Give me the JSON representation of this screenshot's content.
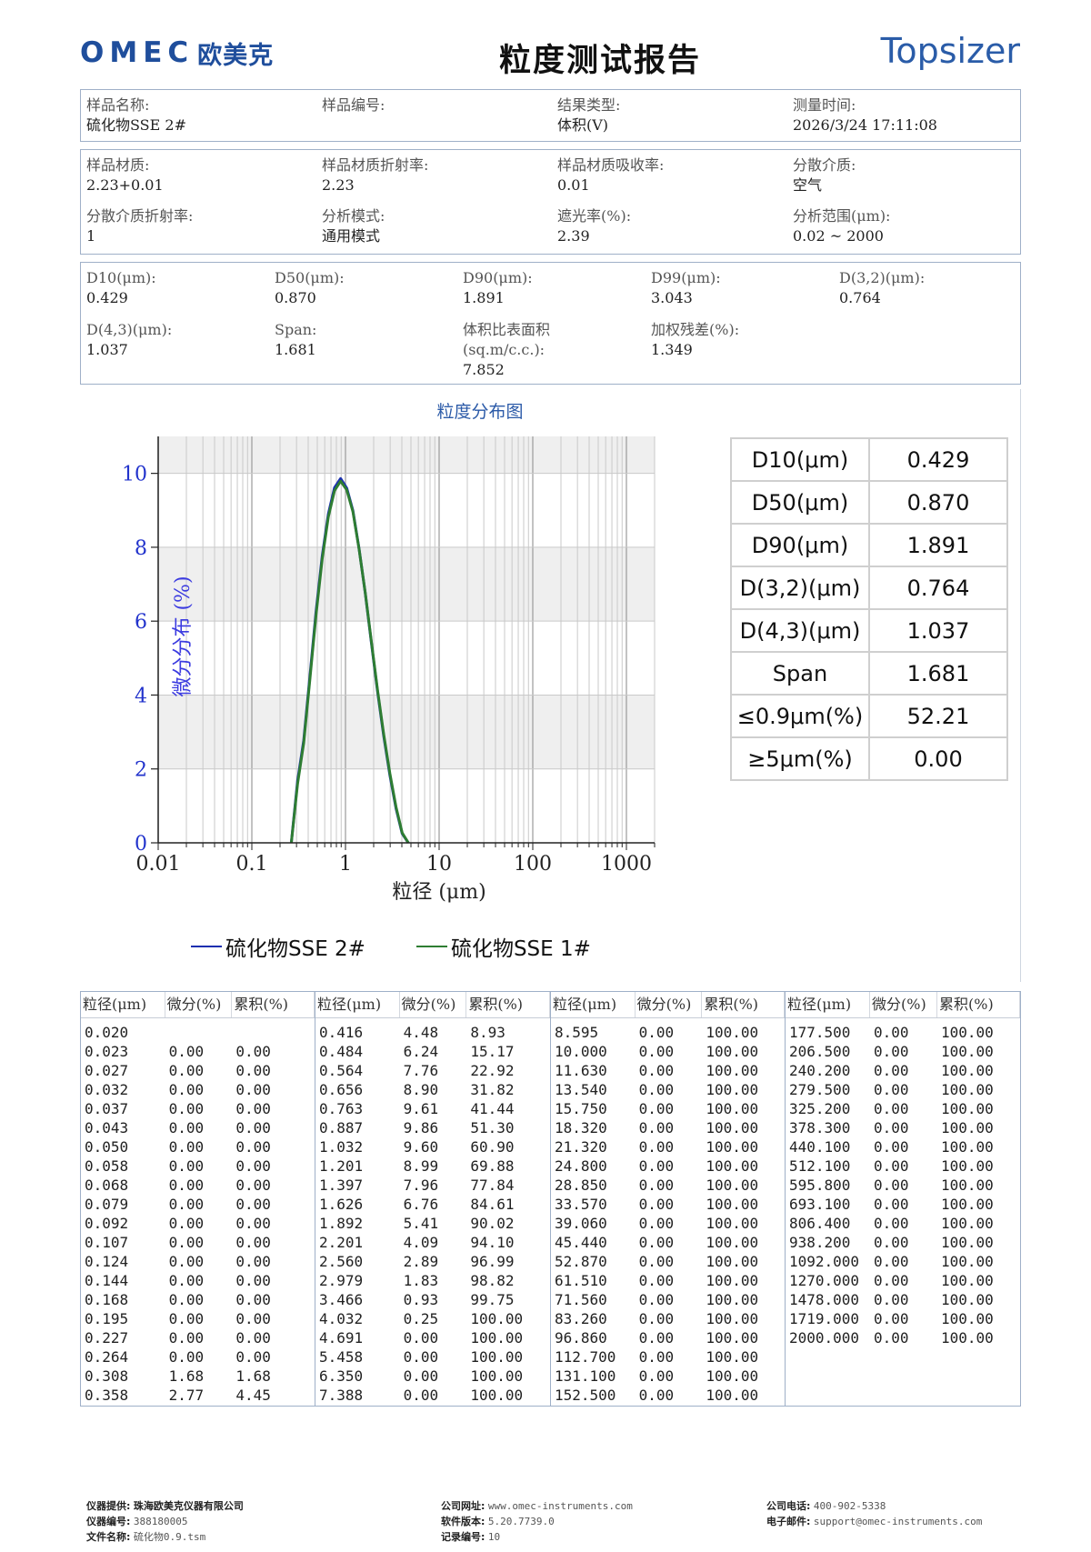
{
  "header": {
    "logo_text": "OMEC",
    "logo_cn": "欧美克",
    "title": "粒度测试报告",
    "brand": "Topsizer"
  },
  "sample": {
    "name_label": "样品名称:",
    "name": "硫化物SSE 2#",
    "id_label": "样品编号:",
    "id": "",
    "result_type_label": "结果类型:",
    "result_type": "体积(V)",
    "time_label": "测量时间:",
    "time": "2026/3/24 17:11:08"
  },
  "material": {
    "mat_label": "样品材质:",
    "mat": "2.23+0.01",
    "ri_label": "样品材质折射率:",
    "ri": "2.23",
    "abs_label": "样品材质吸收率:",
    "abs": "0.01",
    "medium_label": "分散介质:",
    "medium": "空气",
    "medium_ri_label": "分散介质折射率:",
    "medium_ri": "1",
    "mode_label": "分析模式:",
    "mode": "通用模式",
    "obs_label": "遮光率(%):",
    "obs": "2.39",
    "range_label": "分析范围(μm):",
    "range": "0.02 ~ 2000"
  },
  "results": {
    "d10_label": "D10(μm):",
    "d10": "0.429",
    "d50_label": "D50(μm):",
    "d50": "0.870",
    "d90_label": "D90(μm):",
    "d90": "1.891",
    "d99_label": "D99(μm):",
    "d99": "3.043",
    "d32_label": "D(3,2)(μm):",
    "d32": "0.764",
    "d43_label": "D(4,3)(μm):",
    "d43": "1.037",
    "span_label": "Span:",
    "span": "1.681",
    "ssa_label": "体积比表面积(sq.m/c.c.):",
    "ssa": "7.852",
    "resid_label": "加权残差(%):",
    "resid": "1.349"
  },
  "stats_table": [
    {
      "k": "D10(μm)",
      "v": "0.429"
    },
    {
      "k": "D50(μm)",
      "v": "0.870"
    },
    {
      "k": "D90(μm)",
      "v": "1.891"
    },
    {
      "k": "D(3,2)(μm)",
      "v": "0.764"
    },
    {
      "k": "D(4,3)(μm)",
      "v": "1.037"
    },
    {
      "k": "Span",
      "v": "1.681"
    },
    {
      "k": "≤0.9μm(%)",
      "v": "52.21"
    },
    {
      "k": "≥5μm(%)",
      "v": "0.00"
    }
  ],
  "chart_data": {
    "type": "line",
    "title": "粒度分布图",
    "xlabel": "粒径 (μm)",
    "ylabel": "微分分布 (%)",
    "x_scale": "log",
    "xlim": [
      0.01,
      2000
    ],
    "ylim": [
      0,
      11
    ],
    "x_ticks": [
      "0.01",
      "0.1",
      "1",
      "10",
      "100",
      "1000"
    ],
    "y_ticks": [
      "0",
      "2",
      "4",
      "6",
      "8",
      "10"
    ],
    "grid": true,
    "legend_position": "bottom",
    "series": [
      {
        "name": "硫化物SSE 2#",
        "color": "#1a2fb0",
        "x": [
          0.264,
          0.308,
          0.358,
          0.416,
          0.484,
          0.564,
          0.656,
          0.763,
          0.887,
          1.032,
          1.201,
          1.397,
          1.626,
          1.892,
          2.201,
          2.56,
          2.979,
          3.466,
          4.032,
          4.691
        ],
        "y": [
          0.0,
          1.68,
          2.77,
          4.48,
          6.24,
          7.76,
          8.9,
          9.61,
          9.86,
          9.6,
          8.99,
          7.96,
          6.76,
          5.41,
          4.09,
          2.89,
          1.83,
          0.93,
          0.25,
          0.0
        ]
      },
      {
        "name": "硫化物SSE 1#",
        "color": "#2e7d32",
        "x": [
          0.264,
          0.308,
          0.358,
          0.416,
          0.484,
          0.564,
          0.656,
          0.763,
          0.887,
          1.032,
          1.201,
          1.397,
          1.626,
          1.892,
          2.201,
          2.56,
          2.979,
          3.466,
          4.032,
          4.691
        ],
        "y": [
          0.0,
          1.6,
          2.7,
          4.4,
          6.15,
          7.68,
          8.82,
          9.53,
          9.79,
          9.55,
          8.96,
          7.95,
          6.77,
          5.44,
          4.13,
          2.94,
          1.88,
          0.97,
          0.27,
          0.0
        ]
      }
    ]
  },
  "data_table": {
    "headers": [
      "粒径(μm)",
      "微分(%)",
      "累积(%)"
    ],
    "groups": [
      [
        [
          "0.020",
          "",
          ""
        ],
        [
          "0.023",
          "0.00",
          "0.00"
        ],
        [
          "0.027",
          "0.00",
          "0.00"
        ],
        [
          "0.032",
          "0.00",
          "0.00"
        ],
        [
          "0.037",
          "0.00",
          "0.00"
        ],
        [
          "0.043",
          "0.00",
          "0.00"
        ],
        [
          "0.050",
          "0.00",
          "0.00"
        ],
        [
          "0.058",
          "0.00",
          "0.00"
        ],
        [
          "0.068",
          "0.00",
          "0.00"
        ],
        [
          "0.079",
          "0.00",
          "0.00"
        ],
        [
          "0.092",
          "0.00",
          "0.00"
        ],
        [
          "0.107",
          "0.00",
          "0.00"
        ],
        [
          "0.124",
          "0.00",
          "0.00"
        ],
        [
          "0.144",
          "0.00",
          "0.00"
        ],
        [
          "0.168",
          "0.00",
          "0.00"
        ],
        [
          "0.195",
          "0.00",
          "0.00"
        ],
        [
          "0.227",
          "0.00",
          "0.00"
        ],
        [
          "0.264",
          "0.00",
          "0.00"
        ],
        [
          "0.308",
          "1.68",
          "1.68"
        ],
        [
          "0.358",
          "2.77",
          "4.45"
        ]
      ],
      [
        [
          "0.416",
          "4.48",
          "8.93"
        ],
        [
          "0.484",
          "6.24",
          "15.17"
        ],
        [
          "0.564",
          "7.76",
          "22.92"
        ],
        [
          "0.656",
          "8.90",
          "31.82"
        ],
        [
          "0.763",
          "9.61",
          "41.44"
        ],
        [
          "0.887",
          "9.86",
          "51.30"
        ],
        [
          "1.032",
          "9.60",
          "60.90"
        ],
        [
          "1.201",
          "8.99",
          "69.88"
        ],
        [
          "1.397",
          "7.96",
          "77.84"
        ],
        [
          "1.626",
          "6.76",
          "84.61"
        ],
        [
          "1.892",
          "5.41",
          "90.02"
        ],
        [
          "2.201",
          "4.09",
          "94.10"
        ],
        [
          "2.560",
          "2.89",
          "96.99"
        ],
        [
          "2.979",
          "1.83",
          "98.82"
        ],
        [
          "3.466",
          "0.93",
          "99.75"
        ],
        [
          "4.032",
          "0.25",
          "100.00"
        ],
        [
          "4.691",
          "0.00",
          "100.00"
        ],
        [
          "5.458",
          "0.00",
          "100.00"
        ],
        [
          "6.350",
          "0.00",
          "100.00"
        ],
        [
          "7.388",
          "0.00",
          "100.00"
        ]
      ],
      [
        [
          "8.595",
          "0.00",
          "100.00"
        ],
        [
          "10.000",
          "0.00",
          "100.00"
        ],
        [
          "11.630",
          "0.00",
          "100.00"
        ],
        [
          "13.540",
          "0.00",
          "100.00"
        ],
        [
          "15.750",
          "0.00",
          "100.00"
        ],
        [
          "18.320",
          "0.00",
          "100.00"
        ],
        [
          "21.320",
          "0.00",
          "100.00"
        ],
        [
          "24.800",
          "0.00",
          "100.00"
        ],
        [
          "28.850",
          "0.00",
          "100.00"
        ],
        [
          "33.570",
          "0.00",
          "100.00"
        ],
        [
          "39.060",
          "0.00",
          "100.00"
        ],
        [
          "45.440",
          "0.00",
          "100.00"
        ],
        [
          "52.870",
          "0.00",
          "100.00"
        ],
        [
          "61.510",
          "0.00",
          "100.00"
        ],
        [
          "71.560",
          "0.00",
          "100.00"
        ],
        [
          "83.260",
          "0.00",
          "100.00"
        ],
        [
          "96.860",
          "0.00",
          "100.00"
        ],
        [
          "112.700",
          "0.00",
          "100.00"
        ],
        [
          "131.100",
          "0.00",
          "100.00"
        ],
        [
          "152.500",
          "0.00",
          "100.00"
        ]
      ],
      [
        [
          "177.500",
          "0.00",
          "100.00"
        ],
        [
          "206.500",
          "0.00",
          "100.00"
        ],
        [
          "240.200",
          "0.00",
          "100.00"
        ],
        [
          "279.500",
          "0.00",
          "100.00"
        ],
        [
          "325.200",
          "0.00",
          "100.00"
        ],
        [
          "378.300",
          "0.00",
          "100.00"
        ],
        [
          "440.100",
          "0.00",
          "100.00"
        ],
        [
          "512.100",
          "0.00",
          "100.00"
        ],
        [
          "595.800",
          "0.00",
          "100.00"
        ],
        [
          "693.100",
          "0.00",
          "100.00"
        ],
        [
          "806.400",
          "0.00",
          "100.00"
        ],
        [
          "938.200",
          "0.00",
          "100.00"
        ],
        [
          "1092.000",
          "0.00",
          "100.00"
        ],
        [
          "1270.000",
          "0.00",
          "100.00"
        ],
        [
          "1478.000",
          "0.00",
          "100.00"
        ],
        [
          "1719.000",
          "0.00",
          "100.00"
        ],
        [
          "2000.000",
          "0.00",
          "100.00"
        ]
      ]
    ]
  },
  "footer": {
    "provider_label": "仪器提供:",
    "provider": "珠海欧美克仪器有限公司",
    "serial_label": "仪器编号:",
    "serial": "388180005",
    "file_label": "文件名称:",
    "file": "硫化物0.9.tsm",
    "web_label": "公司网址:",
    "web": "www.omec-instruments.com",
    "version_label": "软件版本:",
    "version": "5.20.7739.0",
    "record_label": "记录编号:",
    "record": "10",
    "phone_label": "公司电话:",
    "phone": "400-902-5338",
    "email_label": "电子邮件:",
    "email": "support@omec-instruments.com"
  }
}
